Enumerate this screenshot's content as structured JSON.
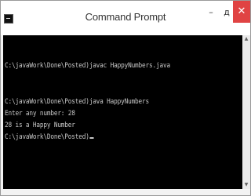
{
  "window": {
    "title": "Command Prompt",
    "controls": {
      "minimize": "–",
      "maximize": "д",
      "close": "✕"
    },
    "icon": "console-app-icon"
  },
  "console": {
    "lines": [
      "",
      "C:\\javaWork\\Done\\Posted)javac HappyNumbers.java",
      "",
      "",
      "C:\\javaWork\\Done\\Posted)java HappyNumbers",
      "Enter any number: 28",
      "28 is a Happy Number",
      "C:\\javaWork\\Done\\Posted)"
    ]
  },
  "colors": {
    "console_bg": "#000000",
    "console_fg": "#c8c8c8",
    "close_button": "#e04343"
  }
}
